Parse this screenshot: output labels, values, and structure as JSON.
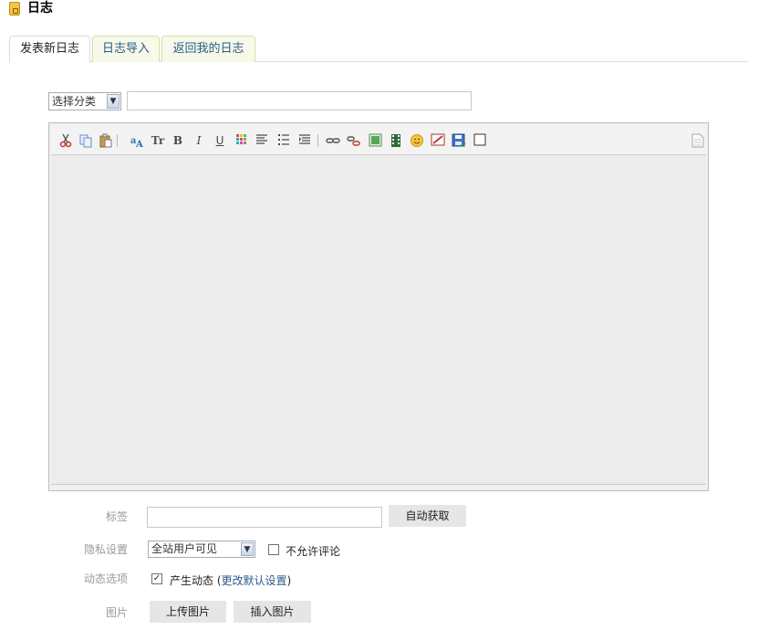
{
  "header": {
    "title": "日志",
    "icon": "notebook-icon"
  },
  "tabs": [
    {
      "label": "发表新日志",
      "active": true
    },
    {
      "label": "日志导入",
      "active": false
    },
    {
      "label": "返回我的日志",
      "active": false
    }
  ],
  "category": {
    "selected": "选择分类"
  },
  "title_input": {
    "value": ""
  },
  "toolbar": {
    "buttons": [
      "cut-icon",
      "copy-icon",
      "paste-icon",
      "font-color-icon",
      "font-size-icon",
      "bold-icon",
      "italic-icon",
      "underline-icon",
      "color-palette-icon",
      "align-icon",
      "bulleted-list-icon",
      "numbered-list-icon",
      "link-icon",
      "unlink-icon",
      "image-icon",
      "video-icon",
      "emoticon-icon",
      "flash-icon",
      "save-draft-icon",
      "checkbox-icon",
      "source-icon"
    ],
    "font_size_label": "Tr",
    "bold_label": "B",
    "italic_label": "I",
    "underline_label": "U"
  },
  "tags": {
    "label": "标签",
    "value": "",
    "auto_button": "自动获取"
  },
  "privacy": {
    "label": "隐私设置",
    "selected": "全站用户可见",
    "no_comment_label": "不允许评论",
    "no_comment_checked": false
  },
  "activity": {
    "label": "动态选项",
    "produce_label": "产生动态",
    "produce_checked": true,
    "paren_open": "(",
    "change_default_link": "更改默认设置",
    "paren_close": ")"
  },
  "images": {
    "label": "图片",
    "upload_button": "上传图片",
    "insert_button": "插入图片"
  },
  "colors": {
    "tab_link": "#2a5a8a",
    "tab_bg": "#f7fae9",
    "editor_bg": "#ececec",
    "button_bg": "#e6e6e6"
  }
}
